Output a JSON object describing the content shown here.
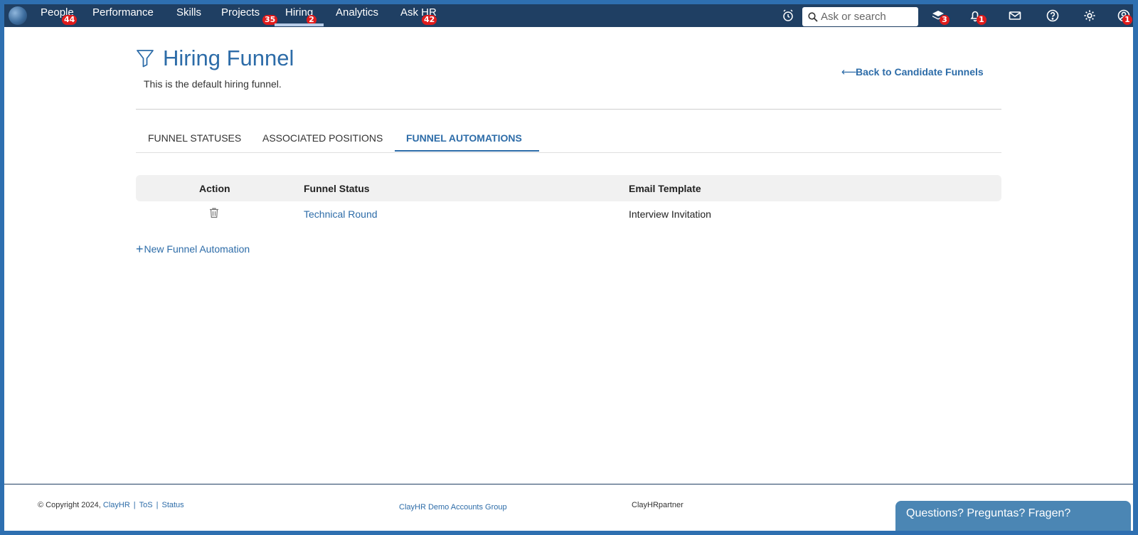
{
  "nav": {
    "items": [
      {
        "label": "People",
        "badge": "44"
      },
      {
        "label": "Performance",
        "badge": ""
      },
      {
        "label": "Skills",
        "badge": ""
      },
      {
        "label": "Projects",
        "badge": "35"
      },
      {
        "label": "Hiring",
        "badge": "2"
      },
      {
        "label": "Analytics",
        "badge": ""
      },
      {
        "label": "Ask HR",
        "badge": "42"
      }
    ],
    "active": "Hiring",
    "search_placeholder": "Ask or search",
    "icons": [
      {
        "name": "alarm-clock-icon",
        "badge": ""
      },
      {
        "name": "stack-layers-icon",
        "badge": "3"
      },
      {
        "name": "bell-icon",
        "badge": "1"
      },
      {
        "name": "mail-icon",
        "badge": ""
      },
      {
        "name": "help-icon",
        "badge": ""
      },
      {
        "name": "gear-icon",
        "badge": ""
      },
      {
        "name": "user-profile-icon",
        "badge": "1"
      }
    ]
  },
  "header": {
    "icon": "funnel-icon",
    "title": "Hiring Funnel",
    "description": "This is the default hiring funnel.",
    "back_link": "Back to Candidate Funnels"
  },
  "tabs": [
    {
      "label": "FUNNEL STATUSES",
      "active": false
    },
    {
      "label": "ASSOCIATED POSITIONS",
      "active": false
    },
    {
      "label": "FUNNEL AUTOMATIONS",
      "active": true
    }
  ],
  "table": {
    "columns": [
      "Action",
      "Funnel Status",
      "Email Template"
    ],
    "rows": [
      {
        "action_icon": "trash-icon",
        "funnel_status": "Technical Round",
        "email_template": "Interview Invitation"
      }
    ]
  },
  "new_automation_label": "New Funnel Automation",
  "footer": {
    "copyright": "© Copyright 2024, ",
    "company_link": "ClayHR",
    "tos": "ToS",
    "status": "Status",
    "group": "ClayHR Demo Accounts Group",
    "partner": "ClayHRpartner"
  },
  "help_widget": "Questions? Preguntas? Fragen?",
  "colors": {
    "nav_bg": "#1f3f63",
    "accent": "#2d6ca8",
    "badge": "#e01b1b",
    "help_widget": "#4b86b4"
  }
}
